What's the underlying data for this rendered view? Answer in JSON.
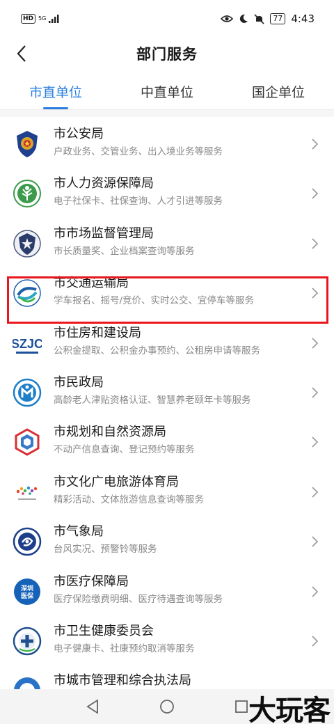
{
  "status_bar": {
    "hd": "HD",
    "network": "5G",
    "battery": "77",
    "time": "4:43"
  },
  "header": {
    "title": "部门服务"
  },
  "tabs": [
    {
      "label": "市直单位",
      "active": true
    },
    {
      "label": "中直单位",
      "active": false
    },
    {
      "label": "国企单位",
      "active": false
    }
  ],
  "departments": [
    {
      "name": "市公安局",
      "desc": "户政业务、交管业务、出入境业务等服务",
      "icon": "police-emblem-icon"
    },
    {
      "name": "市人力资源保障局",
      "desc": "电子社保卡、社保查询、人才引进等服务",
      "icon": "hr-tree-icon"
    },
    {
      "name": "市市场监督管理局",
      "desc": "市长质量奖、企业档案查询等服务",
      "icon": "market-emblem-icon"
    },
    {
      "name": "市交通运输局",
      "desc": "学车报名、摇号/竞价、实时公交、宜停车等服务",
      "icon": "transport-logo-icon"
    },
    {
      "name": "市住房和建设局",
      "desc": "公积金提取、公积金办事预约、公租房申请等服务",
      "icon": "housing-szjc-icon"
    },
    {
      "name": "市民政局",
      "desc": "高龄老人津贴资格认证、智慧养老颐年卡等服务",
      "icon": "civil-affairs-icon"
    },
    {
      "name": "市规划和自然资源局",
      "desc": "不动产信息查询、登记预约等服务",
      "icon": "planning-logo-icon"
    },
    {
      "name": "市文化广电旅游体育局",
      "desc": "精彩活动、文体旅游信息查询等服务",
      "icon": "culture-tourism-icon"
    },
    {
      "name": "市气象局",
      "desc": "台风实况、预警铃等服务",
      "icon": "weather-emblem-icon"
    },
    {
      "name": "市医疗保障局",
      "desc": "医疗保险缴费明细、医疗待遇查询等服务",
      "icon": "medical-insurance-icon"
    },
    {
      "name": "市卫生健康委员会",
      "desc": "电子健康卡、社康预约取消等服务",
      "icon": "health-commission-icon"
    },
    {
      "name": "市城市管理和综合执法局",
      "desc": "",
      "icon": "urban-management-icon"
    }
  ],
  "logo_labels": {
    "housing": "SZJC",
    "medical_line1": "深圳",
    "medical_line2": "医保"
  },
  "watermark": "大玩客",
  "colors": {
    "accent": "#2a7fe0",
    "highlight": "#e8161d"
  }
}
